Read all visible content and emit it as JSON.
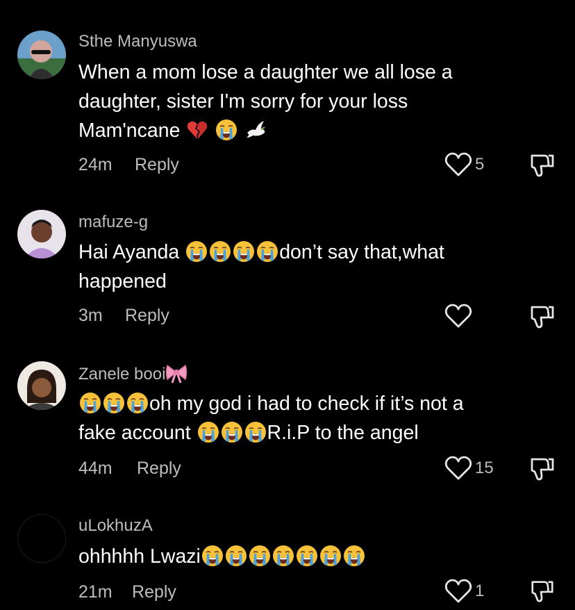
{
  "comments": [
    {
      "username": "Sthe Manyuswa",
      "text_line1": "When a mom lose a daughter we all lose a",
      "text_line2": "daughter, sister I'm sorry for your loss",
      "text_line3": "Mam'ncane",
      "emojis_after_text": [
        "broken-heart-icon",
        "crying-face-icon",
        "dove-icon"
      ],
      "time": "24m",
      "reply_label": "Reply",
      "likes": "5"
    },
    {
      "username": "mafuze-g",
      "text_line1_prefix": "Hai Ayanda",
      "text_line1_suffix": "don’t say that,what",
      "text_line2": "happened",
      "time": "3m",
      "reply_label": "Reply",
      "likes": ""
    },
    {
      "username": "Zanele booi",
      "username_emoji": "ribbon-bow-icon",
      "text_line1_suffix": "oh my god i had to check if it’s not a",
      "text_line2_prefix": "fake account",
      "text_line2_suffix": "R.i.P to the angel",
      "time": "44m",
      "reply_label": "Reply",
      "likes": "15"
    },
    {
      "username": "uLokhuzA",
      "text_line1_prefix": "ohhhhh Lwazi",
      "time": "21m",
      "reply_label": "Reply",
      "likes": "1"
    }
  ],
  "colors": {
    "background": "#000000",
    "primary_text": "#ffffff",
    "secondary_text": "#bdbdbd",
    "emoji_face": "#f7c23a",
    "emoji_tears": "#4aa3df",
    "broken_heart": "#e03b3b",
    "ribbon": "#f49ac1"
  }
}
